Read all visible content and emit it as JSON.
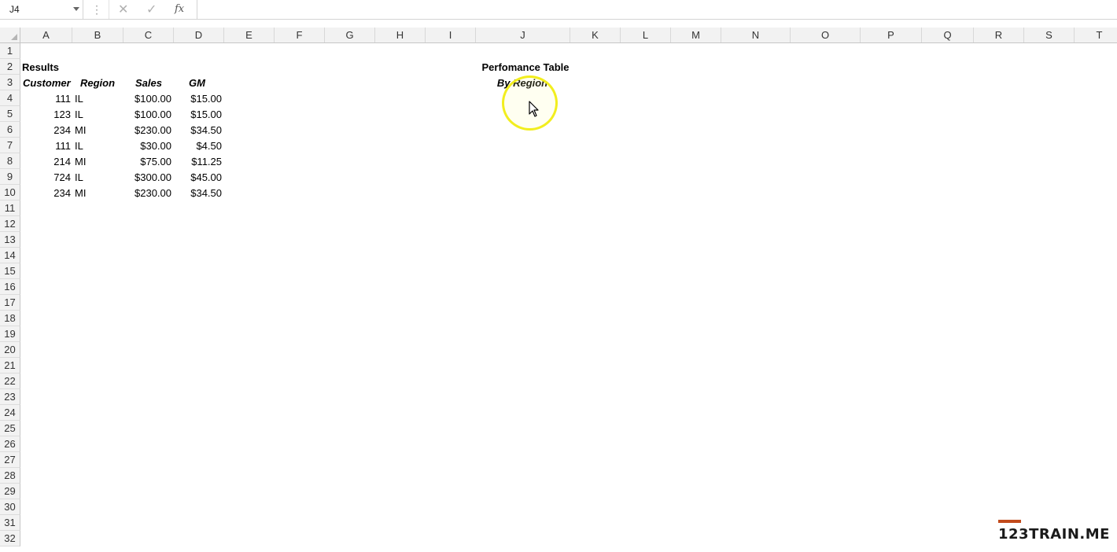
{
  "formula_bar": {
    "name_box": "J4",
    "formula": ""
  },
  "columns": [
    "A",
    "B",
    "C",
    "D",
    "E",
    "F",
    "G",
    "H",
    "I",
    "J",
    "K",
    "L",
    "M",
    "N",
    "O",
    "P",
    "Q",
    "R",
    "S",
    "T"
  ],
  "rows": [
    "1",
    "2",
    "3",
    "4",
    "5",
    "6",
    "7",
    "8",
    "9",
    "10",
    "11",
    "12",
    "13",
    "14",
    "15",
    "16",
    "17",
    "18",
    "19",
    "20",
    "21",
    "22",
    "23",
    "24",
    "25",
    "26",
    "27",
    "28",
    "29",
    "30",
    "31",
    "32"
  ],
  "sheet": {
    "results_title": "Results",
    "headers": {
      "customer": "Customer",
      "region": "Region",
      "sales": "Sales",
      "gm": "GM"
    },
    "data": [
      {
        "customer": "111",
        "region": "IL",
        "sales": "$100.00",
        "gm": "$15.00"
      },
      {
        "customer": "123",
        "region": "IL",
        "sales": "$100.00",
        "gm": "$15.00"
      },
      {
        "customer": "234",
        "region": "MI",
        "sales": "$230.00",
        "gm": "$34.50"
      },
      {
        "customer": "111",
        "region": "IL",
        "sales": "$30.00",
        "gm": "$4.50"
      },
      {
        "customer": "214",
        "region": "MI",
        "sales": "$75.00",
        "gm": "$11.25"
      },
      {
        "customer": "724",
        "region": "IL",
        "sales": "$300.00",
        "gm": "$45.00"
      },
      {
        "customer": "234",
        "region": "MI",
        "sales": "$230.00",
        "gm": "$34.50"
      }
    ],
    "perf_title": "Perfomance Table",
    "perf_subtitle": "By Region"
  },
  "logo": "123TRAIN.ME",
  "colors": {
    "cursor_ring": "#f2ee1e",
    "logo_accent": "#c24a1c"
  }
}
